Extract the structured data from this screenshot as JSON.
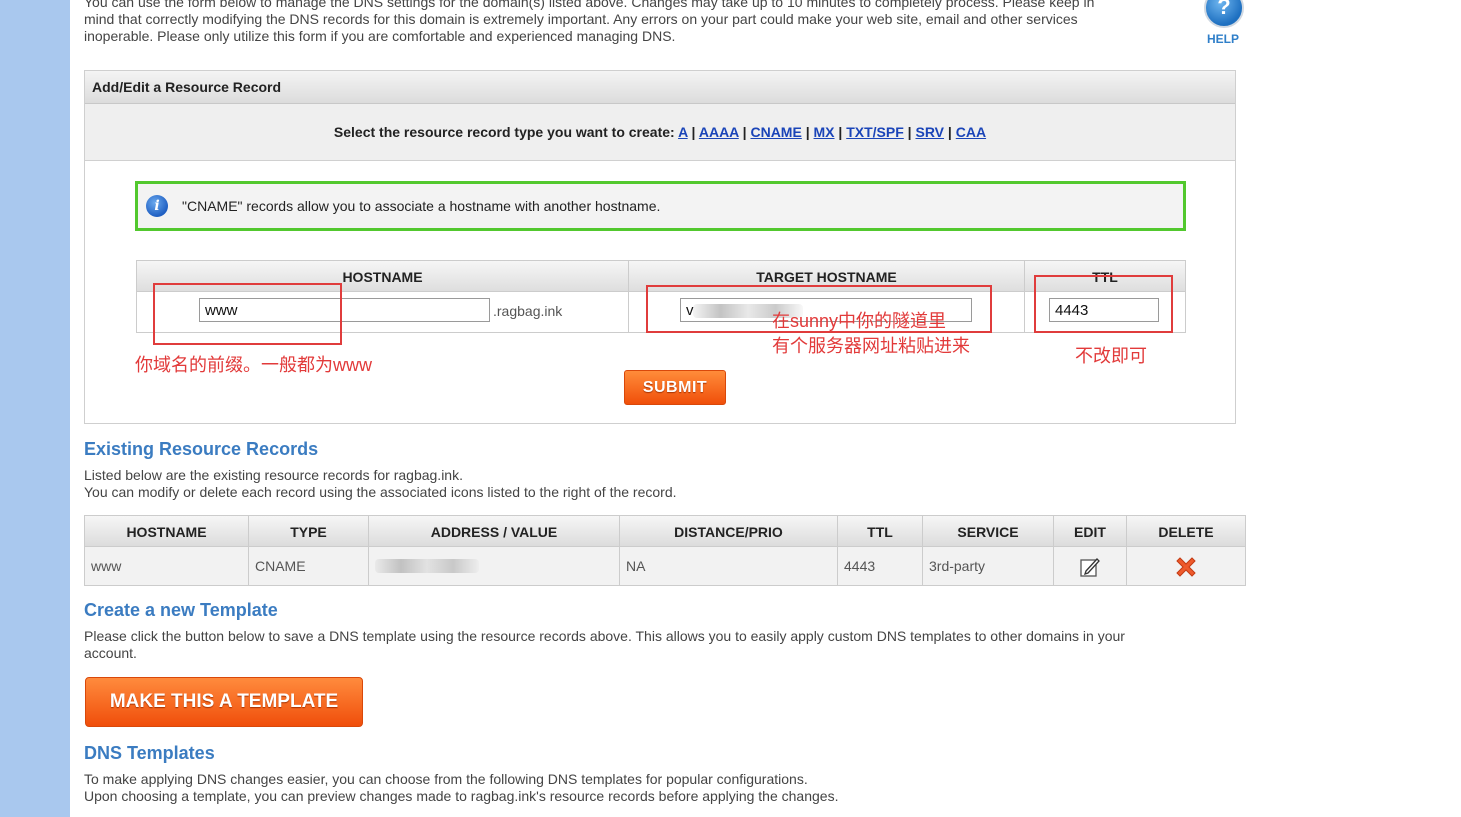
{
  "intro": {
    "line1": "You can use the form below to manage the DNS settings for the domain(s) listed above. Changes may take up to 10 minutes to completely process. Please keep in",
    "line2": "mind that correctly modifying the DNS records for this domain is extremely important. Any errors on your part could make your web site, email and other services",
    "line3": "inoperable. Please only utilize this form if you are comfortable and experienced managing DNS."
  },
  "help": {
    "label": "HELP",
    "icon": "question-icon"
  },
  "add_edit": {
    "title": "Add/Edit a Resource Record",
    "select_prompt": "Select the resource record type you want to create:",
    "types": [
      "A",
      "AAAA",
      "CNAME",
      "MX",
      "TXT/SPF",
      "SRV",
      "CAA"
    ],
    "info_text": "\"CNAME\" records allow you to associate a hostname with another hostname.",
    "columns": {
      "hostname": "HOSTNAME",
      "target": "TARGET HOSTNAME",
      "ttl": "TTL"
    },
    "hostname_value": "www",
    "hostname_suffix": ".ragbag.ink",
    "target_value": "v",
    "ttl_value": "4443",
    "submit_label": "SUBMIT"
  },
  "annotations": {
    "hostname_note": "你域名的前缀。一般都为www",
    "target_note_1": "在sunny中你的隧道里",
    "target_note_2": "有个服务器网址粘贴进来",
    "ttl_note": "不改即可"
  },
  "existing": {
    "title": "Existing Resource Records",
    "desc1": "Listed below are the existing resource records for ragbag.ink.",
    "desc2": "You can modify or delete each record using the associated icons listed to the right of the record.",
    "columns": [
      "HOSTNAME",
      "TYPE",
      "ADDRESS / VALUE",
      "DISTANCE/PRIO",
      "TTL",
      "SERVICE",
      "EDIT",
      "DELETE"
    ],
    "rows": [
      {
        "hostname": "www",
        "type": "CNAME",
        "distance": "NA",
        "ttl": "4443",
        "service": "3rd-party"
      }
    ]
  },
  "template": {
    "title": "Create a new Template",
    "desc1": "Please click the button below to save a DNS template using the resource records above. This allows you to easily apply custom DNS templates to other domains in your",
    "desc2": "account.",
    "button_label": "MAKE THIS A TEMPLATE"
  },
  "dns_templates": {
    "title": "DNS Templates",
    "desc1": "To make applying DNS changes easier, you can choose from the following DNS templates for popular configurations.",
    "desc2": "Upon choosing a template, you can preview changes made to ragbag.ink's resource records before applying the changes."
  },
  "colors": {
    "accent_link": "#1a44b8",
    "heading": "#3b7cc1",
    "button": "#f04f0a",
    "annotation": "#e23a3a",
    "info_border": "#52c82e"
  }
}
